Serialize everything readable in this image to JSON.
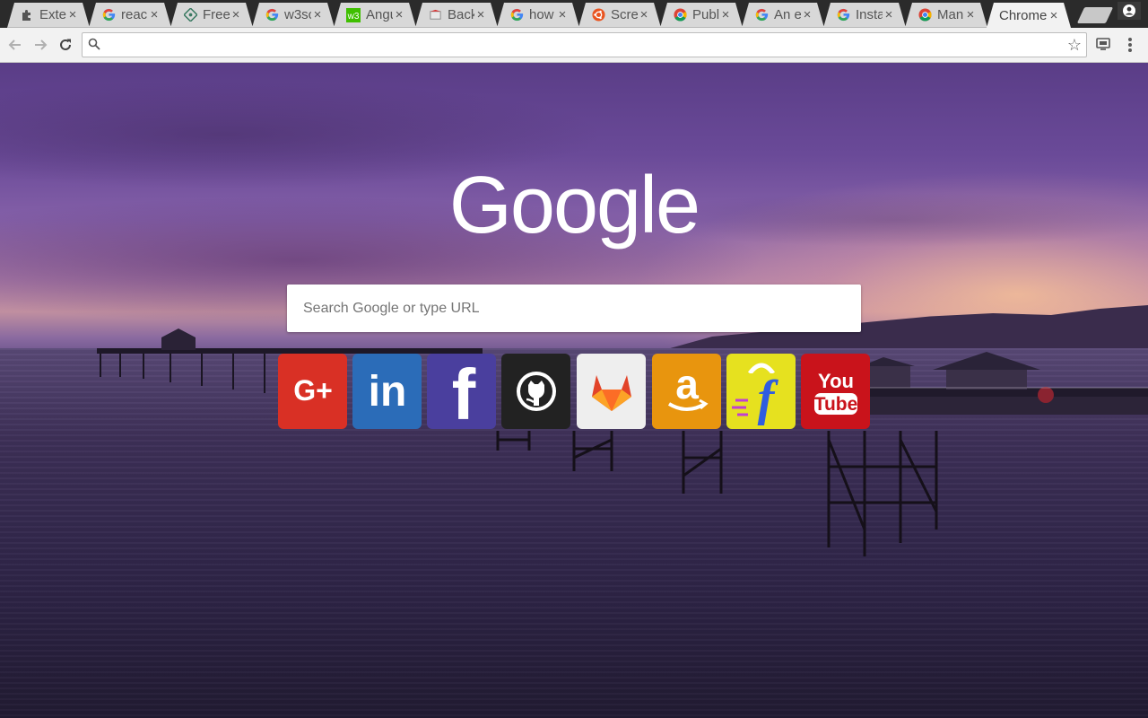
{
  "browser": {
    "tabs": [
      {
        "title": "Exte",
        "icon": "puzzle-icon",
        "active": false
      },
      {
        "title": "reac",
        "icon": "google-g-icon",
        "active": false
      },
      {
        "title": "Free",
        "icon": "freecodecamp-icon",
        "active": false
      },
      {
        "title": "w3sc",
        "icon": "google-g-icon",
        "active": false
      },
      {
        "title": "Angu",
        "icon": "w3-icon",
        "active": false
      },
      {
        "title": "Back",
        "icon": "back-icon",
        "active": false
      },
      {
        "title": "how",
        "icon": "google-g-icon",
        "active": false
      },
      {
        "title": "Scre",
        "icon": "ubuntu-icon",
        "active": false
      },
      {
        "title": "Publ",
        "icon": "chrome-icon",
        "active": false
      },
      {
        "title": "An e",
        "icon": "google-g-icon",
        "active": false
      },
      {
        "title": "Insta",
        "icon": "google-g-icon",
        "active": false
      },
      {
        "title": "Man",
        "icon": "chrome-icon",
        "active": false
      },
      {
        "title": "Chrome",
        "icon": "",
        "active": true
      }
    ],
    "tab_close_glyph": "×",
    "omnibox": {
      "value": "",
      "placeholder": ""
    }
  },
  "page": {
    "logo_text": "Google",
    "search_placeholder": "Search Google or type URL",
    "tiles": [
      {
        "name": "google-plus",
        "glyph": "G+",
        "color": "#d93025"
      },
      {
        "name": "linkedin",
        "glyph": "in",
        "color": "#2b6cb8"
      },
      {
        "name": "facebook",
        "glyph": "f",
        "color": "#4a3f9e"
      },
      {
        "name": "github",
        "glyph": "",
        "color": "#222222"
      },
      {
        "name": "gitlab",
        "glyph": "",
        "color": "#eeeeee"
      },
      {
        "name": "amazon",
        "glyph": "a",
        "color": "#e8950e"
      },
      {
        "name": "flipkart",
        "glyph": "f",
        "color": "#e6e11f"
      },
      {
        "name": "youtube",
        "glyph": "You\nTube",
        "color": "#c9131b"
      }
    ]
  }
}
